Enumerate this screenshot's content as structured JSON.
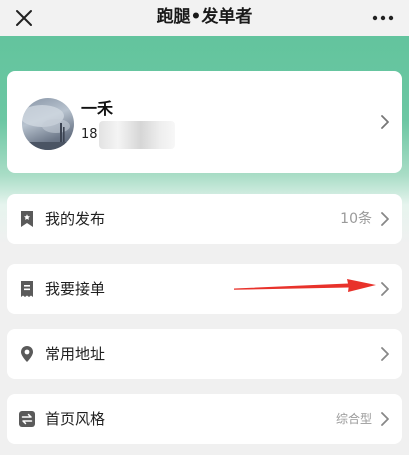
{
  "nav": {
    "title": "跑腿•发单者",
    "close_icon": "close-icon",
    "more_icon": "more-dots-icon"
  },
  "profile": {
    "name": "一禾",
    "phone_prefix": "18",
    "chevron_icon": "chevron-right-icon"
  },
  "menu": {
    "items": [
      {
        "label": "我的发布",
        "value": "10条",
        "icon": "bookmark-icon"
      },
      {
        "label": "我要接单",
        "value": "",
        "icon": "receipt-icon"
      },
      {
        "label": "常用地址",
        "value": "",
        "icon": "location-pin-icon"
      },
      {
        "label": "首页风格",
        "value": "综合型",
        "icon": "swap-icon"
      }
    ]
  },
  "annotation": {
    "arrow_color": "#e8322b",
    "arrow_icon": "red-arrow-annotation"
  },
  "colors": {
    "header_green": "#5fc39b",
    "page_bg": "#f0f0f0",
    "icon_gray": "#5a5a5a",
    "chevron_gray": "#8a8a8a"
  }
}
